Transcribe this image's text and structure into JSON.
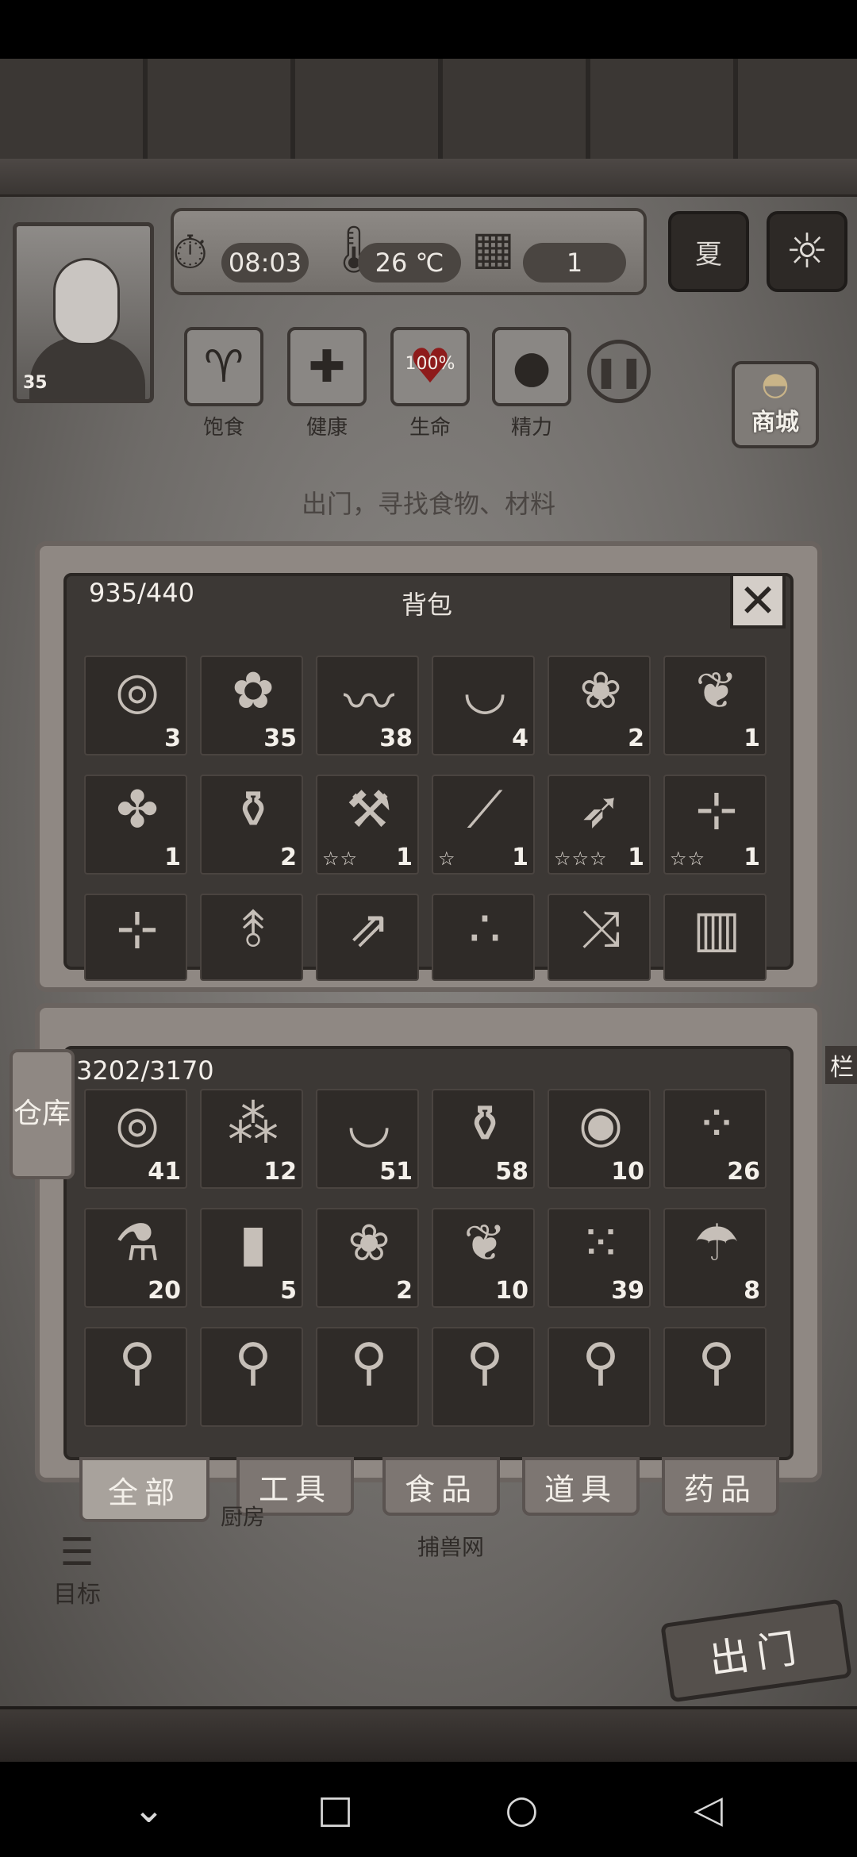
{
  "hud": {
    "time": "08:03",
    "temperature": "26 ℃",
    "day": "1",
    "season": "夏",
    "level": "35"
  },
  "stats": [
    {
      "label": "饱食",
      "icon": "stomach-icon"
    },
    {
      "label": "健康",
      "icon": "cross-icon"
    },
    {
      "label": "生命",
      "icon": "heart-icon",
      "value": "100%"
    },
    {
      "label": "精力",
      "icon": "person-icon"
    }
  ],
  "shop_label": "商城",
  "hint": "出门，寻找食物、材料",
  "bag": {
    "title": "背包",
    "capacity": "935/440",
    "items": [
      {
        "icon": "pie-icon",
        "glyph": "◎",
        "count": "3"
      },
      {
        "icon": "berries-branch-icon",
        "glyph": "✿",
        "count": "35"
      },
      {
        "icon": "bandage-icon",
        "glyph": "〰",
        "count": "38"
      },
      {
        "icon": "bowl-icon",
        "glyph": "◡",
        "count": "4"
      },
      {
        "icon": "flower-icon",
        "glyph": "❀",
        "count": "2"
      },
      {
        "icon": "herb-plant-icon",
        "glyph": "❦",
        "count": "1"
      },
      {
        "icon": "leaf-icon",
        "glyph": "✤",
        "count": "1"
      },
      {
        "icon": "jar-icon",
        "glyph": "⚱",
        "count": "2"
      },
      {
        "icon": "pickaxe-icon",
        "glyph": "⚒",
        "count": "1",
        "stars": "☆☆"
      },
      {
        "icon": "sword-icon",
        "glyph": "⟋",
        "count": "1",
        "stars": "☆"
      },
      {
        "icon": "spear-icon",
        "glyph": "➶",
        "count": "1",
        "stars": "☆☆☆"
      },
      {
        "icon": "crossbow-icon",
        "glyph": "⊹",
        "count": "1",
        "stars": "☆☆"
      },
      {
        "icon": "crossbow-icon",
        "glyph": "⊹",
        "count": "",
        "stars": ""
      },
      {
        "icon": "branch-icon",
        "glyph": "⥉",
        "count": "",
        "stars": ""
      },
      {
        "icon": "arrows-icon",
        "glyph": "⇗",
        "count": "",
        "stars": ""
      },
      {
        "icon": "pellets-icon",
        "glyph": "∴",
        "count": "",
        "stars": ""
      },
      {
        "icon": "bolts-icon",
        "glyph": "⤨",
        "count": "",
        "stars": ""
      },
      {
        "icon": "vest-icon",
        "glyph": "▥",
        "count": "",
        "stars": ""
      }
    ]
  },
  "warehouse": {
    "tab_label": "仓库",
    "capacity": "3202/3170",
    "items": [
      {
        "icon": "pie-icon",
        "glyph": "◎",
        "count": "41"
      },
      {
        "icon": "seeds-icon",
        "glyph": "⁂",
        "count": "12"
      },
      {
        "icon": "bowl-icon",
        "glyph": "◡",
        "count": "51"
      },
      {
        "icon": "glass-jar-icon",
        "glyph": "⚱",
        "count": "58"
      },
      {
        "icon": "pills-icon",
        "glyph": "◉",
        "count": "10"
      },
      {
        "icon": "nuts-icon",
        "glyph": "⁘",
        "count": "26"
      },
      {
        "icon": "potion-bottle-icon",
        "glyph": "⚗",
        "count": "20"
      },
      {
        "icon": "stump-icon",
        "glyph": "▮",
        "count": "5"
      },
      {
        "icon": "flower-icon",
        "glyph": "❀",
        "count": "2"
      },
      {
        "icon": "herb-plant-icon",
        "glyph": "❦",
        "count": "10"
      },
      {
        "icon": "potatoes-icon",
        "glyph": "⁙",
        "count": "39"
      },
      {
        "icon": "mushroom-icon",
        "glyph": "☂",
        "count": "8"
      },
      {
        "icon": "powder-pouch-icon",
        "glyph": "⚲",
        "count": ""
      },
      {
        "icon": "powder-pouch-icon",
        "glyph": "⚲",
        "count": ""
      },
      {
        "icon": "powder-pouch-icon",
        "glyph": "⚲",
        "count": ""
      },
      {
        "icon": "powder-pouch-icon",
        "glyph": "⚲",
        "count": ""
      },
      {
        "icon": "powder-pouch-icon",
        "glyph": "⚲",
        "count": ""
      },
      {
        "icon": "powder-pouch-icon",
        "glyph": "⚲",
        "count": ""
      }
    ]
  },
  "categories": [
    "全部",
    "工具",
    "食品",
    "道具",
    "药品"
  ],
  "map": {
    "kitchen": "厨房",
    "trap_net": "捕兽网",
    "fence": "栏",
    "goal": "目标",
    "go_out": "出门"
  }
}
